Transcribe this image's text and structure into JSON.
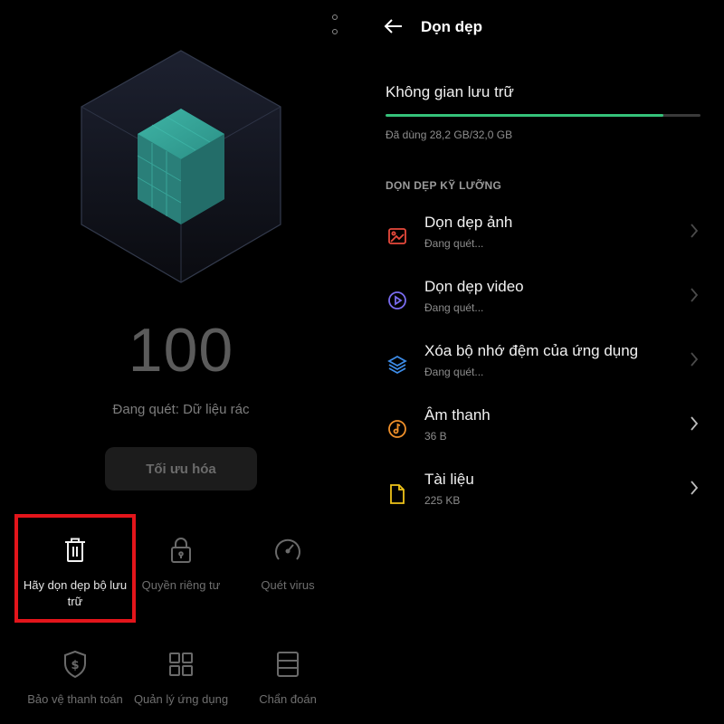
{
  "left_panel": {
    "score": "100",
    "scan_status": "Đang quét: Dữ liệu rác",
    "optimize_label": "Tối ưu hóa",
    "tiles": [
      {
        "label": "Hãy dọn dẹp bộ lưu trữ",
        "icon": "trash-icon",
        "highlighted": true
      },
      {
        "label": "Quyền riêng tư",
        "icon": "lock-icon"
      },
      {
        "label": "Quét virus",
        "icon": "speedometer-icon"
      },
      {
        "label": "Bảo vệ thanh toán",
        "icon": "shield-dollar-icon"
      },
      {
        "label": "Quản lý ứng dụng",
        "icon": "grid-icon"
      },
      {
        "label": "Chẩn đoán",
        "icon": "diagnosis-icon"
      }
    ],
    "highlight_color": "#e3151b"
  },
  "right_panel": {
    "title": "Dọn dẹp",
    "storage_title": "Không gian lưu trữ",
    "storage_used_text": "Đã dùng 28,2 GB/32,0 GB",
    "storage_used_fraction": 0.881,
    "progress_color": "#35c27a",
    "section_header": "DỌN DẸP KỸ LƯỠNG",
    "items": [
      {
        "title": "Dọn dẹp ảnh",
        "subtitle": "Đang quét...",
        "icon": "photo-icon",
        "color": "#e84a3c"
      },
      {
        "title": "Dọn dẹp video",
        "subtitle": "Đang quét...",
        "icon": "play-circle-icon",
        "color": "#7a6cf0"
      },
      {
        "title": "Xóa bộ nhớ đệm của ứng dụng",
        "subtitle": "Đang quét...",
        "icon": "layers-icon",
        "color": "#3d8ce8"
      },
      {
        "title": "Âm thanh",
        "subtitle": "36 B",
        "icon": "music-icon",
        "color": "#f0902a"
      },
      {
        "title": "Tài liệu",
        "subtitle": "225 KB",
        "icon": "document-icon",
        "color": "#f0c419"
      }
    ]
  }
}
